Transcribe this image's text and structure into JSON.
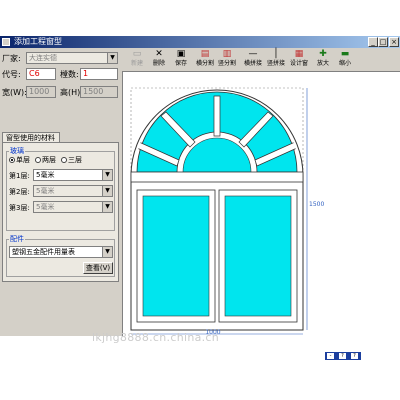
{
  "window": {
    "title": "添加工程窗型",
    "min_label": "_",
    "max_label": "□",
    "close_label": "×"
  },
  "form": {
    "vendor_label": "厂家:",
    "vendor_value": "大连实德",
    "code_label": "代号:",
    "code_value": "C6",
    "count_label": "樘数:",
    "count_value": "1",
    "width_label": "宽(W):",
    "width_value": "1000",
    "height_label": "高(H):",
    "height_value": "1500"
  },
  "materials_tab": {
    "label": "窗型使用的材料",
    "glass_group": "玻璃",
    "radios": [
      {
        "label": "单层",
        "checked": true
      },
      {
        "label": "两层",
        "checked": false
      },
      {
        "label": "三层",
        "checked": false
      }
    ],
    "layers": [
      {
        "label": "第1层:",
        "value": "5毫米",
        "disabled": false
      },
      {
        "label": "第2层:",
        "value": "5毫米",
        "disabled": true
      },
      {
        "label": "第3层:",
        "value": "5毫米",
        "disabled": true
      }
    ],
    "parts_group": "配件",
    "parts_value": "塑钢五金配件用量表",
    "view_button": "查看(V)"
  },
  "toolbar": {
    "items": [
      {
        "label": "新建",
        "icon": "new-icon",
        "enabled": false
      },
      {
        "label": "删除",
        "icon": "delete-icon",
        "enabled": true
      },
      {
        "label": "保存",
        "icon": "save-icon",
        "enabled": true
      },
      {
        "label": "横分割",
        "icon": "hsplit-icon",
        "enabled": true
      },
      {
        "label": "竖分割",
        "icon": "vsplit-icon",
        "enabled": true
      },
      {
        "label": "横拼接",
        "icon": "hjoin-icon",
        "enabled": true
      },
      {
        "label": "竖拼接",
        "icon": "vjoin-icon",
        "enabled": true
      },
      {
        "label": "设计窗",
        "icon": "design-icon",
        "enabled": true
      },
      {
        "label": "放大",
        "icon": "zoom-in-icon",
        "enabled": true
      },
      {
        "label": "缩小",
        "icon": "zoom-out-icon",
        "enabled": true
      }
    ]
  },
  "drawing": {
    "width_dim": "1000",
    "height_dim": "1500",
    "glass_color": "#00e5ee",
    "frame_color": "#ffffff"
  },
  "watermark": "lkjhg8888.cn.china.cn",
  "bottom_bar": {
    "a": "-",
    "b": "?",
    "c": "?"
  }
}
